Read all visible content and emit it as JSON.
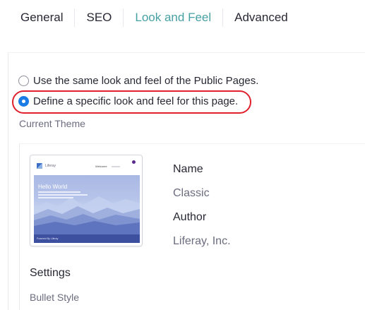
{
  "tabs": [
    {
      "label": "General",
      "active": false
    },
    {
      "label": "SEO",
      "active": false
    },
    {
      "label": "Look and Feel",
      "active": true
    },
    {
      "label": "Advanced",
      "active": false
    }
  ],
  "options": {
    "use_public": {
      "label": "Use the same look and feel of the Public Pages.",
      "checked": false
    },
    "define_specific": {
      "label": "Define a specific look and feel for this page.",
      "checked": true
    }
  },
  "current_theme_label": "Current Theme",
  "theme": {
    "thumbnail": {
      "brand": "Liferay",
      "nav_item": "Welcome",
      "hero_title": "Hello World",
      "footer": "Powered By Liferay"
    },
    "name_label": "Name",
    "name_value": "Classic",
    "author_label": "Author",
    "author_value": "Liferay, Inc."
  },
  "settings": {
    "heading": "Settings",
    "bullet_style_label": "Bullet Style"
  },
  "colors": {
    "accent": "#47a0a4",
    "radio_selected": "#1c7ce5",
    "highlight": "#e0202c"
  }
}
